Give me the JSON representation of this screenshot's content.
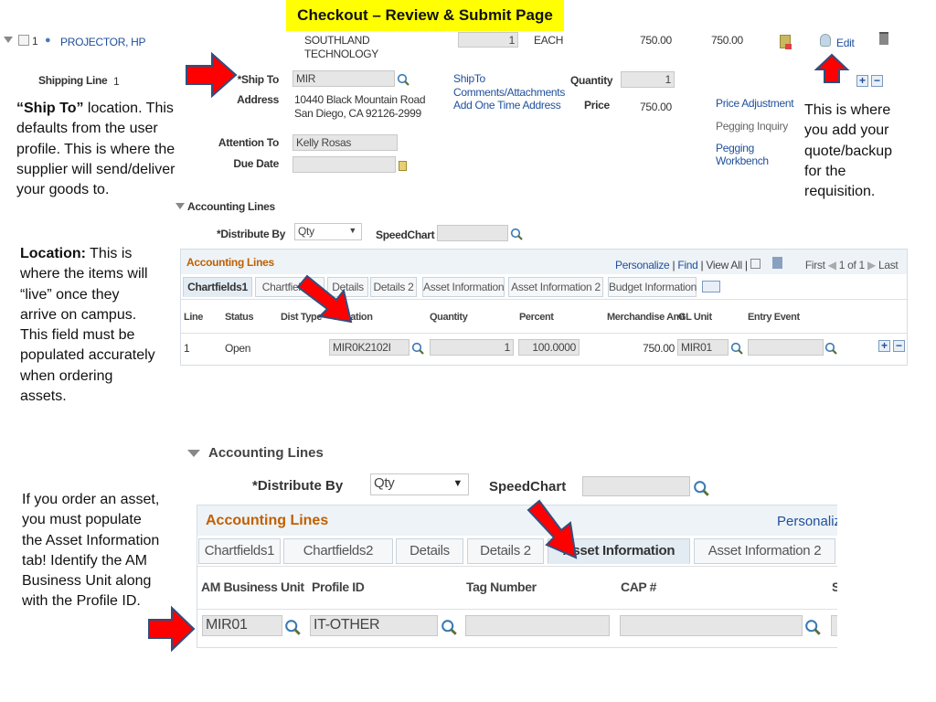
{
  "title": "Checkout – Review & Submit Page",
  "line": {
    "number": "1",
    "item": "PROJECTOR, HP",
    "supplier": [
      "SOUTHLAND",
      "TECHNOLOGY"
    ],
    "quantity": "1",
    "uom": "EACH",
    "price": "750.00",
    "amount": "750.00",
    "edit_label": "Edit"
  },
  "shipping": {
    "shipping_line_label": "Shipping Line",
    "shipping_line_value": "1",
    "ship_to_label": "*Ship To",
    "ship_to_value": "MIR",
    "address_label": "Address",
    "address": [
      "10440 Black Mountain Road",
      "San Diego, CA  92126-2999"
    ],
    "attention_label": "Attention To",
    "attention_value": "Kelly Rosas",
    "due_date_label": "Due Date",
    "due_date_value": "",
    "links": [
      "ShipTo",
      "Comments/Attachments",
      "Add One Time Address"
    ],
    "quantity_label": "Quantity",
    "quantity_value": "1",
    "price_label": "Price",
    "price_value": "750.00",
    "price_adjustment": "Price Adjustment",
    "pegging_inquiry": "Pegging Inquiry",
    "pegging_workbench": [
      "Pegging",
      "Workbench"
    ]
  },
  "notes": {
    "ship_to": {
      "bold": "“Ship To”",
      "lines": [
        " location.  This",
        "defaults from the user",
        "profile.  This is where the",
        "supplier will send/deliver",
        "your goods to."
      ]
    },
    "edit": [
      "This is where",
      "you add your",
      "quote/backup",
      "for the",
      "requisition."
    ],
    "location": {
      "bold": "Location:",
      "lines": [
        " This is",
        "where the items will",
        "“live” once they",
        "arrive on campus.",
        "This field must be",
        "populated accurately",
        "when ordering",
        "assets."
      ]
    },
    "asset": [
      "If you order an asset,",
      "you must populate",
      "the Asset Information",
      "tab! Identify the AM",
      "Business Unit along",
      "with the Profile ID."
    ]
  },
  "accounting": {
    "section_label": "Accounting Lines",
    "distribute_label": "*Distribute By",
    "distribute_value": "Qty",
    "speedchart_label": "SpeedChart",
    "grid_title": "Accounting Lines",
    "nav": {
      "personalize": "Personalize",
      "find": "Find",
      "view_all": "View All",
      "first": "First",
      "page": "1 of 1",
      "last": "Last",
      "sep": "|"
    },
    "tabs": [
      "Chartfields1",
      "Chartfields2",
      "Details",
      "Details 2",
      "Asset Information",
      "Asset Information 2",
      "Budget Information"
    ],
    "columns": [
      "Line",
      "Status",
      "Dist Type",
      "*Location",
      "Quantity",
      "Percent",
      "Merchandise Amt",
      "GL Unit",
      "Entry Event"
    ],
    "row": {
      "line": "1",
      "status": "Open",
      "dist_type": "",
      "location": "MIR0K2102I",
      "quantity": "1",
      "percent": "100.0000",
      "merch_amt": "750.00",
      "gl_unit": "MIR01",
      "entry_event": ""
    }
  },
  "asset_view": {
    "section_label": "Accounting Lines",
    "distribute_label": "*Distribute By",
    "distribute_value": "Qty",
    "speedchart_label": "SpeedChart",
    "grid_title": "Accounting Lines",
    "personalize": "Personaliz",
    "tabs": [
      "Chartfields1",
      "Chartfields2",
      "Details",
      "Details 2",
      "Asset Information",
      "Asset Information 2"
    ],
    "columns": [
      "AM Business Unit",
      "Profile ID",
      "Tag Number",
      "CAP #",
      "S"
    ],
    "row": {
      "am_business_unit": "MIR01",
      "profile_id": "IT-OTHER",
      "tag_number": "",
      "cap": ""
    }
  },
  "colors": {
    "title_bg": "#ffff00",
    "link": "#1f4f9c",
    "grid_title": "#c06000",
    "arrow": "#ff0000"
  }
}
